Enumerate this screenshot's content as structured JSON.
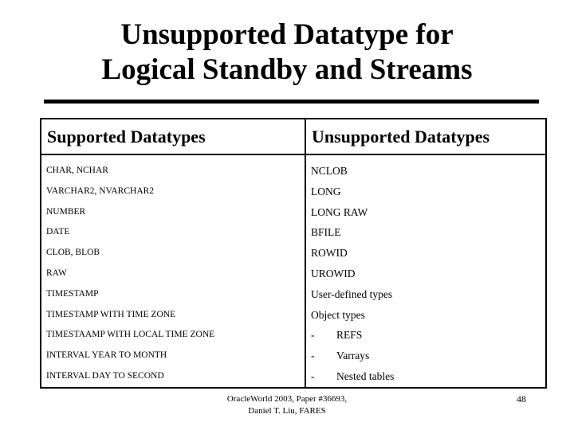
{
  "slide": {
    "title_lines": [
      "Unsupported Datatype for",
      "Logical Standby and Streams"
    ],
    "accent_color": "#000000",
    "background_color": "#ffffff"
  },
  "table": {
    "headers": [
      "Supported Datatypes",
      "Unsupported Datatypes"
    ],
    "supported": [
      "CHAR, NCHAR",
      "VARCHAR2, NVARCHAR2",
      "NUMBER",
      "DATE",
      "CLOB, BLOB",
      "RAW",
      "TIMESTAMP",
      "TIMESTAMP WITH TIME ZONE",
      "TIMESTAAMP WITH LOCAL TIME ZONE",
      "INTERVAL YEAR TO MONTH",
      "INTERVAL DAY TO SECOND"
    ],
    "unsupported": [
      {
        "text": "NCLOB",
        "dash": false
      },
      {
        "text": "LONG",
        "dash": false
      },
      {
        "text": "LONG RAW",
        "dash": false
      },
      {
        "text": "BFILE",
        "dash": false
      },
      {
        "text": "ROWID",
        "dash": false
      },
      {
        "text": "UROWID",
        "dash": false
      },
      {
        "text": "User-defined types",
        "dash": false
      },
      {
        "text": "Object types",
        "dash": false
      },
      {
        "text": "REFS",
        "dash": true
      },
      {
        "text": "Varrays",
        "dash": true
      },
      {
        "text": "Nested tables",
        "dash": true
      }
    ],
    "dash_marker": "-"
  },
  "footer": {
    "lines": [
      "OracleWorld 2003, Paper #36693,",
      "Daniel T. Liu, FARES"
    ],
    "page_number": "48"
  }
}
